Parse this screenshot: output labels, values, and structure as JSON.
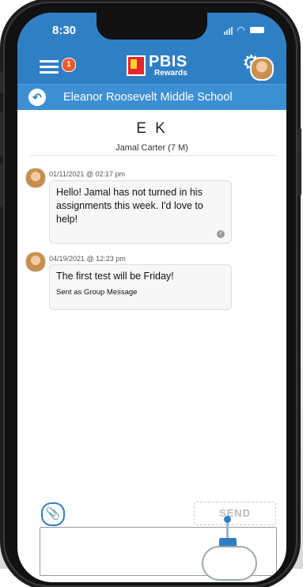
{
  "status": {
    "time": "8:30"
  },
  "header": {
    "notification_count": "1",
    "logo_main": "PBIS",
    "logo_sub": "Rewards",
    "school": "Eleanor Roosevelt Middle School"
  },
  "conversation": {
    "initials": "E K",
    "student": "Jamal Carter (7 M)"
  },
  "messages": [
    {
      "timestamp": "01/11/2021 @ 02:17 pm",
      "text": "Hello! Jamal has not turned in his assignments this week. I'd love to help!"
    },
    {
      "timestamp": "04/19/2021 @ 12:23 pm",
      "text": "The first test will be Friday!",
      "note": "Sent as Group Message"
    }
  ],
  "composer": {
    "send_label": "SEND",
    "placeholder": ""
  },
  "icons": {
    "menu": "hamburger-icon",
    "settings": "gear-icon",
    "back": "back-arrow-icon",
    "attach": "paperclip-icon",
    "read": "check-icon"
  },
  "colors": {
    "primary": "#2f7fc5",
    "badge": "#f15a29"
  }
}
